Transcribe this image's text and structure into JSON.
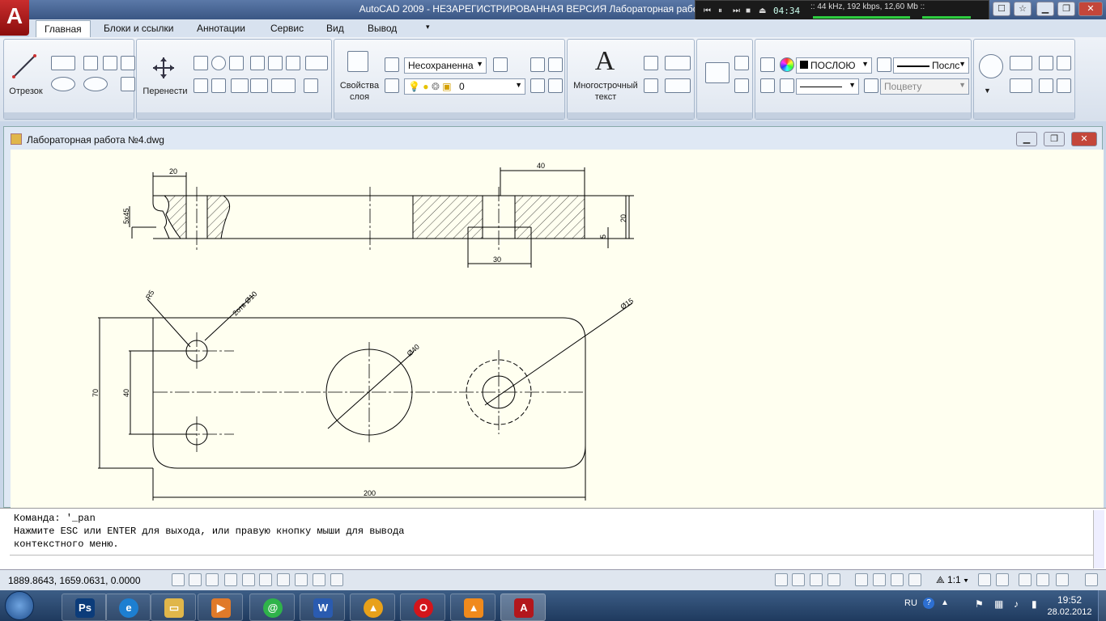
{
  "window": {
    "title": "AutoCAD 2009 - НЕЗАРЕГИСТРИРОВАННАЯ ВЕРСИЯ Лабораторная работа №4.dwg",
    "logo": "A"
  },
  "player": {
    "time": "04:34",
    "info": ":: 44 kHz, 192 kbps, 12,60 Mb ::"
  },
  "menu": {
    "tabs": [
      "Главная",
      "Блоки и ссылки",
      "Аннотации",
      "Сервис",
      "Вид",
      "Вывод"
    ],
    "active_tab": "Главная"
  },
  "ribbon": {
    "draw": {
      "line_label": "Отрезок"
    },
    "modify": {
      "move_label": "Перенести"
    },
    "layers": {
      "properties_label": "Свойства слоя",
      "layer_state": "Несохраненна",
      "current_layer": "0"
    },
    "annotation": {
      "mtext_label": "Многострочный текст",
      "mtext_icon": "A"
    },
    "properties": {
      "color": "ПОСЛОЮ",
      "lineweight": "Послс",
      "plot_style": "Поцвету"
    }
  },
  "drawing_window": {
    "title": "Лабораторная работа №4.dwg"
  },
  "drawing": {
    "dims_top": [
      "20",
      "5x45",
      "40",
      "20",
      "5",
      "30"
    ],
    "dims_bottom": [
      "R5",
      "2отв Ø10",
      "Ø15",
      "Ø40",
      "70",
      "40",
      "200"
    ]
  },
  "command_line": {
    "lines": [
      "Команда: '_pan",
      "Нажмите ESC или ENTER для выхода, или правую кнопку мыши для вывода",
      "контекстного меню."
    ]
  },
  "status_bar": {
    "coordinates": "1889.8643, 1659.0631, 0.0000",
    "scale": "1:1"
  },
  "taskbar": {
    "apps": [
      {
        "name": "Photoshop",
        "glyph": "Ps",
        "color": "#0c3c7a"
      },
      {
        "name": "Internet Explorer",
        "glyph": "e",
        "color": "#1d7fd1"
      },
      {
        "name": "Explorer",
        "glyph": "▭",
        "color": "#e0b64a"
      },
      {
        "name": "Media",
        "glyph": "▶",
        "color": "#e07a2a"
      },
      {
        "name": "Mail.ru Agent",
        "glyph": "@",
        "color": "#2fb34a"
      },
      {
        "name": "Word",
        "glyph": "W",
        "color": "#2a5bb0"
      },
      {
        "name": "Archicad",
        "glyph": "▲",
        "color": "#e8a11a"
      },
      {
        "name": "Opera",
        "glyph": "O",
        "color": "#d3151b"
      },
      {
        "name": "VLC",
        "glyph": "▲",
        "color": "#f08a1c"
      },
      {
        "name": "AutoCAD",
        "glyph": "A",
        "color": "#b3171c"
      }
    ],
    "language": "RU",
    "time": "19:52",
    "date": "28.02.2012"
  }
}
